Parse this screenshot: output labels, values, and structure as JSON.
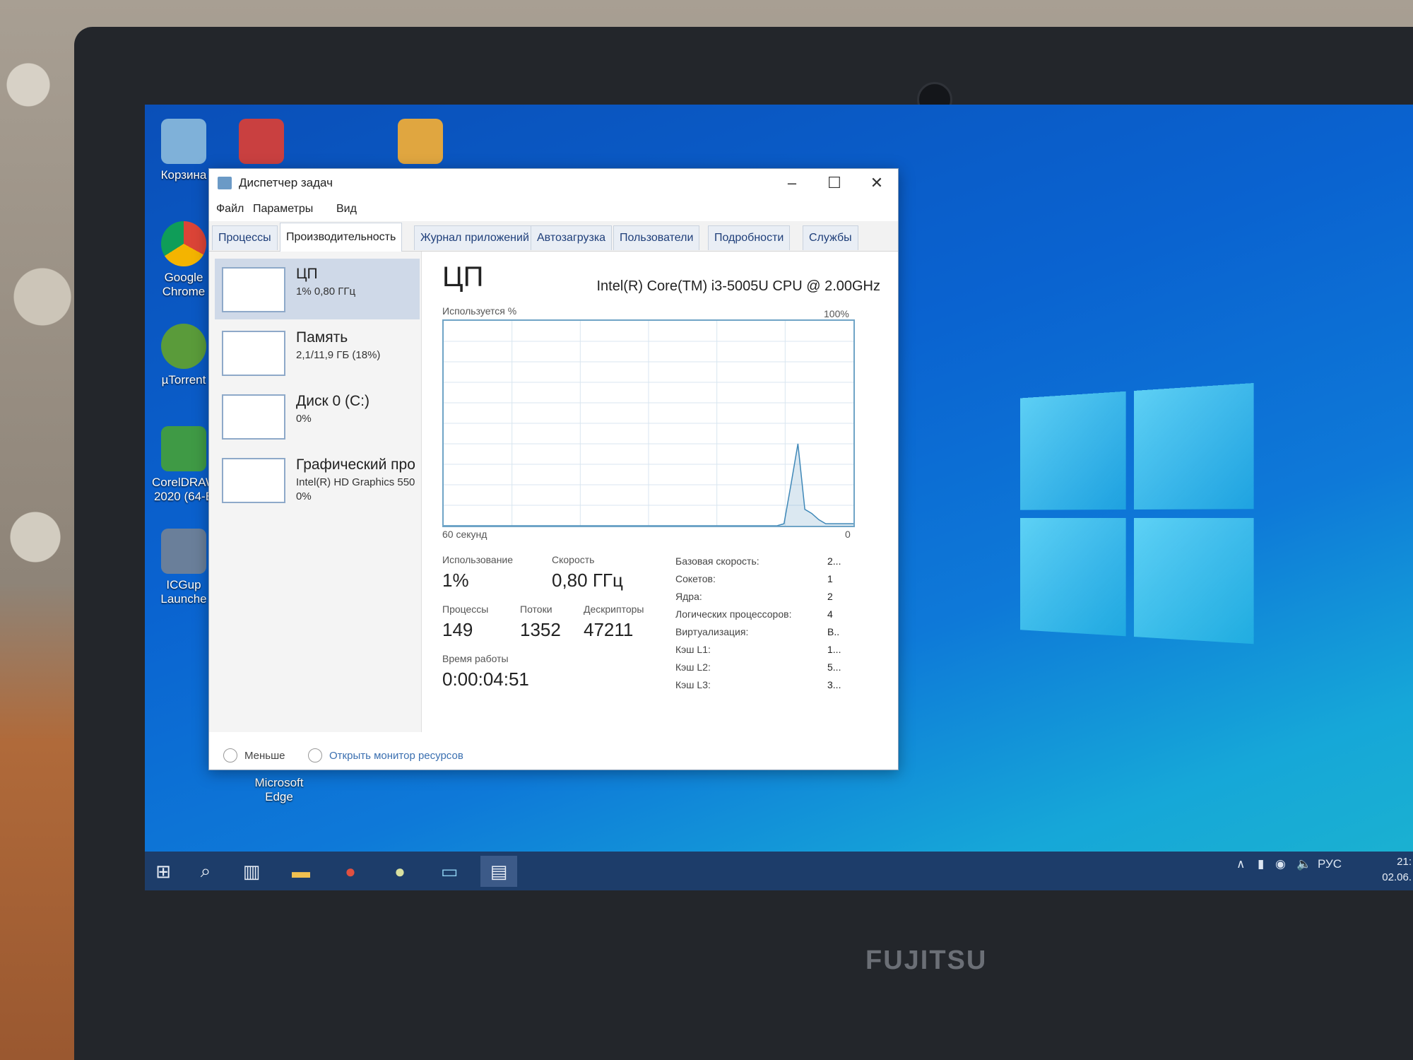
{
  "desktop": {
    "icons": [
      {
        "label": "Корзина"
      },
      {
        "label": ""
      },
      {
        "label": ""
      },
      {
        "label": "Google Chrome"
      },
      {
        "label": "µTorrent"
      },
      {
        "label": "CorelDRAW 2020 (64-B"
      },
      {
        "label": "ICGup Launche"
      },
      {
        "label": "Microsoft Edge"
      }
    ]
  },
  "window": {
    "title": "Диспетчер задач",
    "menu": [
      "Файл",
      "Параметры",
      "Вид"
    ],
    "tabs": [
      "Процессы",
      "Производительность",
      "Журнал приложений",
      "Автозагрузка",
      "Пользователи",
      "Подробности",
      "Службы"
    ]
  },
  "resources": [
    {
      "name": "ЦП",
      "sub": "1% 0,80 ГГц",
      "sub2": ""
    },
    {
      "name": "Память",
      "sub": "2,1/11,9 ГБ (18%)",
      "sub2": ""
    },
    {
      "name": "Диск 0 (C:)",
      "sub": "0%",
      "sub2": ""
    },
    {
      "name": "Графический про",
      "sub": "Intel(R) HD Graphics 550",
      "sub2": "0%"
    }
  ],
  "cpu": {
    "title": "ЦП",
    "model": "Intel(R) Core(TM) i3-5005U CPU @ 2.00GHz",
    "usage_label": "Используется %",
    "max_label": "100%",
    "time_label": "60 секунд",
    "zero_label": "0",
    "stats": {
      "usage_k": "Использование",
      "usage_v": "1%",
      "speed_k": "Скорость",
      "speed_v": "0,80 ГГц",
      "proc_k": "Процессы",
      "proc_v": "149",
      "threads_k": "Потоки",
      "threads_v": "1352",
      "handles_k": "Дескрипторы",
      "handles_v": "47211",
      "uptime_k": "Время работы",
      "uptime_v": "0:00:04:51"
    },
    "info": [
      {
        "k": "Базовая скорость:",
        "v": "2..."
      },
      {
        "k": "Сокетов:",
        "v": "1"
      },
      {
        "k": "Ядра:",
        "v": "2"
      },
      {
        "k": "Логических процессоров:",
        "v": "4"
      },
      {
        "k": "Виртуализация:",
        "v": "В.."
      },
      {
        "k": "Кэш L1:",
        "v": "1..."
      },
      {
        "k": "Кэш L2:",
        "v": "5..."
      },
      {
        "k": "Кэш L3:",
        "v": "3..."
      }
    ],
    "graph_series": [
      0,
      0,
      0,
      0,
      0,
      0,
      0,
      0,
      0,
      0,
      0,
      0,
      0,
      0,
      0,
      0,
      0,
      0,
      0,
      0,
      0,
      0,
      0,
      0,
      0,
      0,
      0,
      0,
      0,
      0,
      0,
      0,
      0,
      0,
      0,
      0,
      0,
      0,
      0,
      0,
      0,
      0,
      0,
      0,
      0,
      0,
      0,
      0,
      0,
      1,
      20,
      40,
      8,
      6,
      3,
      1,
      1,
      1,
      1,
      1
    ]
  },
  "footer": {
    "less": "Меньше",
    "monitor": "Открыть монитор ресурсов"
  },
  "tray": {
    "lang": "РУС",
    "time": "21:",
    "date": "02.06."
  },
  "bezel": {
    "brand": "FUJITSU"
  }
}
